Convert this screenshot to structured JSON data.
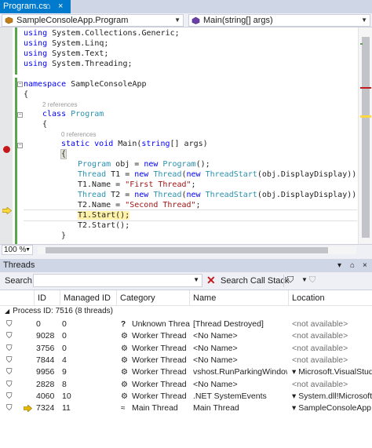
{
  "tab": {
    "title": "Program.cs",
    "pin": "⌂",
    "close": "×"
  },
  "nav": {
    "left": "SampleConsoleApp.Program",
    "right": "Main(string[] args)"
  },
  "code": {
    "usings": [
      "using System.Collections.Generic;",
      "using System.Linq;",
      "using System.Text;",
      "using System.Threading;"
    ],
    "ns_kw": "namespace",
    "ns_name": " SampleConsoleApp",
    "brace_open": "{",
    "brace_close": "}",
    "refs_class": "2 references",
    "class_kw": "class",
    "class_name": "Program",
    "refs_main": "0 references",
    "main_kw1": "static",
    "main_kw2": "void",
    "main_rest": " Main(",
    "main_kw3": "string",
    "main_end": "[] args)",
    "l1a": "Program",
    "l1b": " obj = ",
    "l1c": "new",
    "l1d": "Program",
    "l1e": "();",
    "l2a": "Thread",
    "l2b": " T1 = ",
    "l2c": "new",
    "l2d": "Thread",
    "l2e": "(",
    "l2f": "new",
    "l2g": "ThreadStart",
    "l2h": "(obj.DisplayDisplay));",
    "l3a": "T1.Name = ",
    "l3b": "\"First Thread\"",
    "l3c": ";",
    "l4a": "Thread",
    "l4b": " T2 = ",
    "l4c": "new",
    "l4d": "Thread",
    "l4e": "(",
    "l4f": "new",
    "l4g": "ThreadStart",
    "l4h": "(obj.DisplayDisplay));",
    "l5a": "T2.Name = ",
    "l5b": "\"Second Thread\"",
    "l5c": ";",
    "l6": "T1.Start();",
    "l7": "T2.Start();"
  },
  "zoom": "100 %",
  "threads": {
    "title": "Threads",
    "search_label": "Search:",
    "search_call_stack": "Search Call Stack",
    "columns": [
      "ID",
      "Managed ID",
      "Category",
      "Name",
      "Location"
    ],
    "group": "Process ID: 7516  (8 threads)",
    "rows": [
      {
        "id": "0",
        "managed": "0",
        "cat_icon": "?",
        "category": "Unknown Thread",
        "name": "[Thread Destroyed]",
        "location": "<not available>",
        "loc_na": true
      },
      {
        "id": "9028",
        "managed": "0",
        "cat_icon": "⚙",
        "category": "Worker Thread",
        "name": "<No Name>",
        "location": "<not available>",
        "loc_na": true
      },
      {
        "id": "3756",
        "managed": "0",
        "cat_icon": "⚙",
        "category": "Worker Thread",
        "name": "<No Name>",
        "location": "<not available>",
        "loc_na": true
      },
      {
        "id": "7844",
        "managed": "4",
        "cat_icon": "⚙",
        "category": "Worker Thread",
        "name": "<No Name>",
        "location": "<not available>",
        "loc_na": true
      },
      {
        "id": "9956",
        "managed": "9",
        "cat_icon": "⚙",
        "category": "Worker Thread",
        "name": "vshost.RunParkingWindow",
        "location": "▾ Microsoft.VisualStud",
        "loc_na": false
      },
      {
        "id": "2828",
        "managed": "8",
        "cat_icon": "⚙",
        "category": "Worker Thread",
        "name": "<No Name>",
        "location": "<not available>",
        "loc_na": true
      },
      {
        "id": "4060",
        "managed": "10",
        "cat_icon": "⚙",
        "category": "Worker Thread",
        "name": ".NET SystemEvents",
        "location": "▾ System.dll!Microsoft.",
        "loc_na": false
      },
      {
        "id": "7324",
        "managed": "11",
        "cat_icon": "≈",
        "category": "Main Thread",
        "name": "Main Thread",
        "location": "▾ SampleConsoleApp.",
        "loc_na": false
      }
    ]
  },
  "colors": {
    "accent": "#007acc",
    "breakpoint": "#c5181b",
    "change": "#57a64a",
    "current_line": "#fff1a8",
    "arrow": "#e6b800"
  }
}
